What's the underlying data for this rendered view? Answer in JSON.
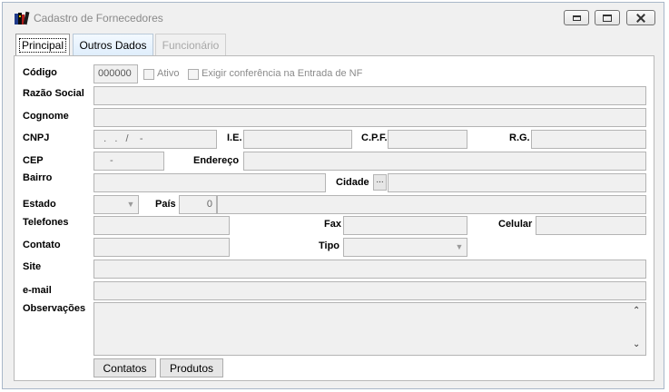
{
  "window": {
    "title": "Cadastro de Fornecedores",
    "icon": "books-icon"
  },
  "tabs": [
    {
      "label": "Principal",
      "active": true,
      "enabled": true
    },
    {
      "label": "Outros Dados",
      "active": false,
      "enabled": true
    },
    {
      "label": "Funcionário",
      "active": false,
      "enabled": false
    }
  ],
  "form": {
    "codigo": {
      "label": "Código",
      "value": "000000"
    },
    "ativo": {
      "label": "Ativo",
      "checked": false
    },
    "exigir": {
      "label": "Exigir conferência na Entrada de NF",
      "checked": false
    },
    "razao_social": {
      "label": "Razão Social",
      "value": ""
    },
    "cognome": {
      "label": "Cognome",
      "value": ""
    },
    "cnpj": {
      "label": "CNPJ",
      "value": "  .   .   /    -"
    },
    "ie": {
      "label": "I.E.",
      "value": ""
    },
    "cpf": {
      "label": "C.P.F.",
      "value": ""
    },
    "rg": {
      "label": "R.G.",
      "value": ""
    },
    "cep": {
      "label": "CEP",
      "value": "-"
    },
    "endereco": {
      "label": "Endereço",
      "value": ""
    },
    "bairro": {
      "label": "Bairro",
      "value": ""
    },
    "cidade": {
      "label": "Cidade",
      "button": "...",
      "value": ""
    },
    "estado": {
      "label": "Estado",
      "value": ""
    },
    "pais": {
      "label": "País",
      "code": "0",
      "name": ""
    },
    "telefones": {
      "label": "Telefones",
      "value": ""
    },
    "fax": {
      "label": "Fax",
      "value": ""
    },
    "celular": {
      "label": "Celular",
      "value": ""
    },
    "contato": {
      "label": "Contato",
      "value": ""
    },
    "tipo": {
      "label": "Tipo",
      "value": ""
    },
    "site": {
      "label": "Site",
      "value": ""
    },
    "email": {
      "label": "e-mail",
      "value": ""
    },
    "observacoes": {
      "label": "Observações",
      "value": ""
    }
  },
  "buttons": {
    "contatos": "Contatos",
    "produtos": "Produtos"
  }
}
